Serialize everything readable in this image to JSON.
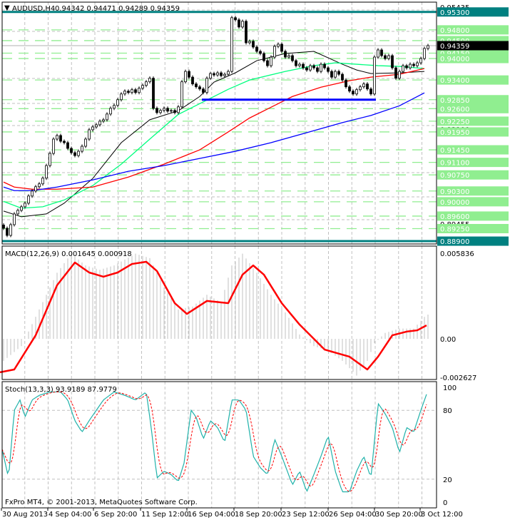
{
  "header": {
    "symbol": "AUDUSD,H4",
    "ohlc": "0.94342 0.94471 0.94289 0.94359"
  },
  "copyright": "FxPro MT4, © 2001-2013, MetaQuotes Software Corp.",
  "colors": {
    "level_box": "#90ee90",
    "key_level": "#008080",
    "support_line": "#0000ff",
    "ma_fast": "#000000",
    "ma_mid": "#00ff7f",
    "ma_slow": "#ff0000",
    "ma_long": "#0000ff",
    "macd_hist": "#c0c0c0",
    "macd_signal": "#ff0000",
    "stoch_main": "#20b2aa",
    "stoch_signal": "#ff0000"
  },
  "chart_data": [
    {
      "type": "candlestick",
      "title": "AUDUSD,H4",
      "ylim": [
        0.88735,
        0.95435
      ],
      "x_tick_labels": [
        "30 Aug 2013",
        "4 Sep 04:00",
        "6 Sep 20:00",
        "11 Sep 12:00",
        "16 Sep 04:00",
        "18 Sep 20:00",
        "23 Sep 12:00",
        "26 Sep 04:00",
        "30 Sep 20:00",
        "3 Oct 12:00"
      ],
      "axis_tick_labels": [
        "0.95435",
        "0.92775",
        "0.92100",
        "0.90130",
        "0.89455"
      ],
      "first_open": 0.8935,
      "closes": [
        0.8926,
        0.8906,
        0.8936,
        0.8966,
        0.8976,
        0.8986,
        0.8996,
        0.9016,
        0.903,
        0.9042,
        0.905,
        0.9066,
        0.9101,
        0.9135,
        0.9175,
        0.9185,
        0.9169,
        0.9165,
        0.9149,
        0.9137,
        0.9129,
        0.9141,
        0.9155,
        0.9175,
        0.9201,
        0.9209,
        0.9215,
        0.9225,
        0.9229,
        0.9245,
        0.9261,
        0.9269,
        0.9285,
        0.9301,
        0.9309,
        0.9305,
        0.9313,
        0.9305,
        0.9317,
        0.9325,
        0.9335,
        0.9345,
        0.9261,
        0.9249,
        0.9255,
        0.9261,
        0.9253,
        0.9255,
        0.9249,
        0.9265,
        0.9335,
        0.9364,
        0.9348,
        0.9329,
        0.9321,
        0.9315,
        0.9305,
        0.9345,
        0.9358,
        0.9354,
        0.936,
        0.9352,
        0.9356,
        0.9364,
        0.9514,
        0.9508,
        0.9488,
        0.9504,
        0.9444,
        0.9448,
        0.9432,
        0.942,
        0.9414,
        0.9394,
        0.938,
        0.9404,
        0.9434,
        0.944,
        0.942,
        0.9404,
        0.9408,
        0.9394,
        0.938,
        0.9384,
        0.9374,
        0.9368,
        0.938,
        0.9374,
        0.9364,
        0.9384,
        0.9374,
        0.9364,
        0.9348,
        0.9364,
        0.9356,
        0.934,
        0.9321,
        0.9309,
        0.9301,
        0.9313,
        0.9321,
        0.9329,
        0.9315,
        0.9301,
        0.9404,
        0.9424,
        0.9408,
        0.94,
        0.9408,
        0.9374,
        0.9345,
        0.9364,
        0.938,
        0.9374,
        0.9384,
        0.938,
        0.9388,
        0.94,
        0.9428,
        0.9436
      ],
      "moving_averages": [
        {
          "name": "ma_fast",
          "points": [
            [
              0,
              0.8974
            ],
            [
              5,
              0.8958
            ],
            [
              12,
              0.8966
            ],
            [
              17,
              0.8996
            ],
            [
              25,
              0.9065
            ],
            [
              33,
              0.9165
            ],
            [
              41,
              0.9229
            ],
            [
              49,
              0.9254
            ],
            [
              55,
              0.9294
            ],
            [
              59,
              0.9334
            ],
            [
              65,
              0.936
            ],
            [
              71,
              0.9394
            ],
            [
              79,
              0.9414
            ],
            [
              87,
              0.942
            ],
            [
              95,
              0.9384
            ],
            [
              99,
              0.9368
            ],
            [
              103,
              0.9358
            ],
            [
              111,
              0.936
            ],
            [
              118,
              0.9364
            ]
          ]
        },
        {
          "name": "ma_mid",
          "points": [
            [
              0,
              0.9001
            ],
            [
              5,
              0.8982
            ],
            [
              11,
              0.8986
            ],
            [
              17,
              0.9005
            ],
            [
              25,
              0.9045
            ],
            [
              33,
              0.9105
            ],
            [
              41,
              0.9175
            ],
            [
              49,
              0.9244
            ],
            [
              55,
              0.9274
            ],
            [
              63,
              0.9314
            ],
            [
              69,
              0.934
            ],
            [
              79,
              0.9364
            ],
            [
              87,
              0.938
            ],
            [
              93,
              0.9388
            ],
            [
              99,
              0.9384
            ],
            [
              105,
              0.938
            ],
            [
              111,
              0.9378
            ],
            [
              118,
              0.9372
            ]
          ]
        },
        {
          "name": "ma_slow",
          "points": [
            [
              0,
              0.9055
            ],
            [
              3,
              0.9041
            ],
            [
              8,
              0.9035
            ],
            [
              15,
              0.9035
            ],
            [
              25,
              0.9041
            ],
            [
              35,
              0.9069
            ],
            [
              45,
              0.9105
            ],
            [
              55,
              0.9145
            ],
            [
              63,
              0.9195
            ],
            [
              69,
              0.9234
            ],
            [
              75,
              0.9264
            ],
            [
              81,
              0.9294
            ],
            [
              89,
              0.932
            ],
            [
              97,
              0.9338
            ],
            [
              103,
              0.9348
            ],
            [
              111,
              0.9356
            ],
            [
              118,
              0.9372
            ]
          ]
        },
        {
          "name": "ma_long",
          "points": [
            [
              0,
              0.9041
            ],
            [
              3,
              0.9031
            ],
            [
              8,
              0.9031
            ],
            [
              15,
              0.9041
            ],
            [
              25,
              0.9061
            ],
            [
              35,
              0.9085
            ],
            [
              45,
              0.9101
            ],
            [
              55,
              0.9121
            ],
            [
              65,
              0.9141
            ],
            [
              75,
              0.9165
            ],
            [
              85,
              0.9193
            ],
            [
              95,
              0.9221
            ],
            [
              103,
              0.9241
            ],
            [
              111,
              0.9268
            ],
            [
              118,
              0.9304
            ]
          ]
        }
      ],
      "support_line": {
        "price": 0.9285,
        "from_bar": 55.6,
        "to_bar": 104.4
      },
      "key_levels": [
        {
          "label": "0.95300",
          "price": 0.953
        },
        {
          "label": "0.88900",
          "price": 0.889
        }
      ],
      "current_price": {
        "label": "0.94359",
        "price": 0.94359
      },
      "levels": [
        {
          "label": "0.94800",
          "price": 0.948
        },
        {
          "label": "0.94500",
          "price": 0.945
        },
        {
          "label": "0.94150",
          "price": 0.9415
        },
        {
          "label": "0.94000",
          "price": 0.94
        },
        {
          "label": "0.93400",
          "price": 0.934
        },
        {
          "label": "0.92850",
          "price": 0.9285
        },
        {
          "label": "0.92600",
          "price": 0.926
        },
        {
          "label": "0.92250",
          "price": 0.9225
        },
        {
          "label": "0.91950",
          "price": 0.9195
        },
        {
          "label": "0.91450",
          "price": 0.9145
        },
        {
          "label": "0.91100",
          "price": 0.911
        },
        {
          "label": "0.90750",
          "price": 0.9075
        },
        {
          "label": "0.90300",
          "price": 0.903
        },
        {
          "label": "0.90000",
          "price": 0.9
        },
        {
          "label": "0.89600",
          "price": 0.896
        },
        {
          "label": "0.89250",
          "price": 0.8925
        }
      ]
    },
    {
      "type": "bar",
      "title": "MACD(12,26,9) 0.001645 0.000918",
      "ylim": [
        -0.002627,
        0.005836
      ],
      "tick_labels": [
        {
          "label": "0.005836",
          "value": 0.005836
        },
        {
          "label": "0.00",
          "value": 0
        },
        {
          "label": "-0.002627",
          "value": -0.002627
        }
      ],
      "histogram_anchors": [
        [
          -1,
          -0.0017
        ],
        [
          5,
          -0.0005
        ],
        [
          11,
          0.0025
        ],
        [
          15,
          0.0045
        ],
        [
          19,
          0.0058
        ],
        [
          23,
          0.005
        ],
        [
          27,
          0.0047
        ],
        [
          31,
          0.005
        ],
        [
          37,
          0.0058
        ],
        [
          41,
          0.0055
        ],
        [
          45,
          0.0035
        ],
        [
          49,
          0.002
        ],
        [
          53,
          0.0022
        ],
        [
          57,
          0.003
        ],
        [
          61,
          0.0025
        ],
        [
          64,
          0.005
        ],
        [
          67,
          0.0058
        ],
        [
          71,
          0.0045
        ],
        [
          75,
          0.003
        ],
        [
          79,
          0.0018
        ],
        [
          83,
          0.0003
        ],
        [
          87,
          -0.0005
        ],
        [
          91,
          -0.0008
        ],
        [
          95,
          -0.0015
        ],
        [
          99,
          -0.0025
        ],
        [
          102,
          -0.0015
        ],
        [
          104,
          -0.0003
        ],
        [
          107,
          0.0004
        ],
        [
          111,
          0.0007
        ],
        [
          115,
          0.0007
        ],
        [
          118.6,
          0.00165
        ]
      ],
      "signal_anchors": [
        [
          -1,
          -0.00228
        ],
        [
          3,
          -0.00209
        ],
        [
          9,
          0.00024
        ],
        [
          15,
          0.00365
        ],
        [
          20,
          0.0052
        ],
        [
          24,
          0.00452
        ],
        [
          28,
          0.00423
        ],
        [
          32,
          0.00452
        ],
        [
          36,
          0.0051
        ],
        [
          40,
          0.00525
        ],
        [
          43,
          0.00462
        ],
        [
          48,
          0.00243
        ],
        [
          51.4,
          0.0017
        ],
        [
          57,
          0.00258
        ],
        [
          63,
          0.00243
        ],
        [
          67,
          0.00437
        ],
        [
          70,
          0.005
        ],
        [
          73,
          0.00437
        ],
        [
          78,
          0.00243
        ],
        [
          83,
          0.00097
        ],
        [
          90,
          -0.00073
        ],
        [
          97,
          -0.00122
        ],
        [
          102,
          -0.00209
        ],
        [
          105,
          -0.00122
        ],
        [
          109,
          0.00024
        ],
        [
          113,
          0.00049
        ],
        [
          116,
          0.00058
        ],
        [
          118.6,
          0.000918
        ]
      ]
    },
    {
      "type": "line",
      "title": "Stoch(13,3,3) 93.9189 87.9779",
      "ylim": [
        0,
        100
      ],
      "tick_labels": [
        {
          "label": "100",
          "value": 100
        },
        {
          "label": "80",
          "value": 80
        },
        {
          "label": "20",
          "value": 20
        },
        {
          "label": "0",
          "value": 0
        }
      ],
      "main_anchors": [
        [
          -0.4,
          46
        ],
        [
          1.4,
          21
        ],
        [
          3,
          80
        ],
        [
          4.6,
          89
        ],
        [
          6,
          74
        ],
        [
          8,
          89
        ],
        [
          10,
          93
        ],
        [
          13,
          96
        ],
        [
          16,
          96
        ],
        [
          18,
          89
        ],
        [
          20,
          71
        ],
        [
          22,
          61
        ],
        [
          24,
          71
        ],
        [
          26,
          80
        ],
        [
          28,
          89
        ],
        [
          31,
          96
        ],
        [
          34,
          93
        ],
        [
          37,
          89
        ],
        [
          40,
          96
        ],
        [
          41.4,
          65
        ],
        [
          43,
          21
        ],
        [
          45,
          27
        ],
        [
          47,
          24
        ],
        [
          49,
          18
        ],
        [
          50.6,
          34
        ],
        [
          52.6,
          80
        ],
        [
          54,
          74
        ],
        [
          56,
          55
        ],
        [
          58,
          71
        ],
        [
          60,
          65
        ],
        [
          62,
          52
        ],
        [
          64,
          89
        ],
        [
          66,
          89
        ],
        [
          68,
          80
        ],
        [
          70,
          40
        ],
        [
          72,
          30
        ],
        [
          74,
          24
        ],
        [
          76,
          55
        ],
        [
          78,
          40
        ],
        [
          81,
          15
        ],
        [
          83,
          27
        ],
        [
          85,
          9
        ],
        [
          87,
          24
        ],
        [
          89,
          40
        ],
        [
          91,
          58
        ],
        [
          93,
          27
        ],
        [
          95,
          9
        ],
        [
          97,
          9
        ],
        [
          99,
          27
        ],
        [
          101,
          40
        ],
        [
          103,
          21
        ],
        [
          105,
          86
        ],
        [
          107,
          77
        ],
        [
          109,
          65
        ],
        [
          111,
          43
        ],
        [
          113,
          65
        ],
        [
          115,
          61
        ],
        [
          117,
          80
        ],
        [
          118.6,
          93.9
        ]
      ]
    }
  ]
}
